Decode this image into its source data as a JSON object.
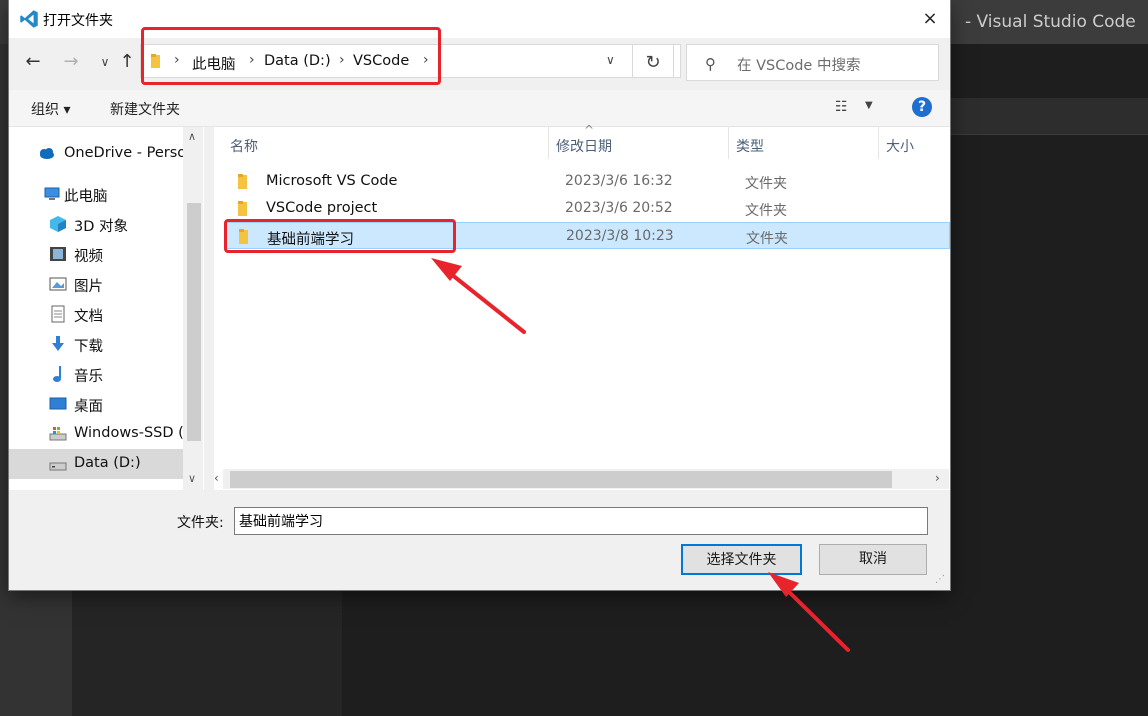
{
  "vscode": {
    "title_suffix": "- Visual Studio Code"
  },
  "dialog": {
    "title": "打开文件夹",
    "close_icon": "×"
  },
  "nav": {
    "back": "←",
    "forward": "→",
    "recent": "∨",
    "up": "↑"
  },
  "address": {
    "crumbs": [
      "此电脑",
      "Data (D:)",
      "VSCode"
    ],
    "separator": "›",
    "dropdown": "∨"
  },
  "refresh_icon": "↻",
  "search": {
    "icon": "⚲",
    "placeholder": "在 VSCode 中搜索"
  },
  "toolbar": {
    "organize": "组织 ▾",
    "new_folder": "新建文件夹",
    "view_icon": "☷",
    "view_dropdown": "▼",
    "help": "?"
  },
  "navpane": {
    "items": [
      {
        "label": "OneDrive - Perso",
        "icon": "cloud-icon"
      },
      {
        "label": "此电脑",
        "icon": "computer-icon"
      },
      {
        "label": "3D 对象",
        "icon": "cube-icon"
      },
      {
        "label": "视频",
        "icon": "film-icon"
      },
      {
        "label": "图片",
        "icon": "picture-icon"
      },
      {
        "label": "文档",
        "icon": "document-icon"
      },
      {
        "label": "下载",
        "icon": "download-icon"
      },
      {
        "label": "音乐",
        "icon": "music-icon"
      },
      {
        "label": "桌面",
        "icon": "desktop-icon"
      },
      {
        "label": "Windows-SSD (",
        "icon": "drive-icon"
      },
      {
        "label": "Data (D:)",
        "icon": "drive-icon",
        "selected": true
      }
    ]
  },
  "filelist": {
    "columns": [
      "名称",
      "修改日期",
      "类型",
      "大小"
    ],
    "sort_indicator": "^",
    "rows": [
      {
        "name": "Microsoft VS Code",
        "date": "2023/3/6 16:32",
        "type": "文件夹"
      },
      {
        "name": "VSCode project",
        "date": "2023/3/6 20:52",
        "type": "文件夹"
      },
      {
        "name": "基础前端学习",
        "date": "2023/3/8 10:23",
        "type": "文件夹",
        "selected": true
      }
    ]
  },
  "bottom": {
    "folder_label": "文件夹:",
    "folder_value": "基础前端学习",
    "select_button": "选择文件夹",
    "cancel_button": "取消"
  },
  "colors": {
    "annotation": "#e8232b",
    "selection": "#cce8ff",
    "accent": "#0078d7"
  }
}
